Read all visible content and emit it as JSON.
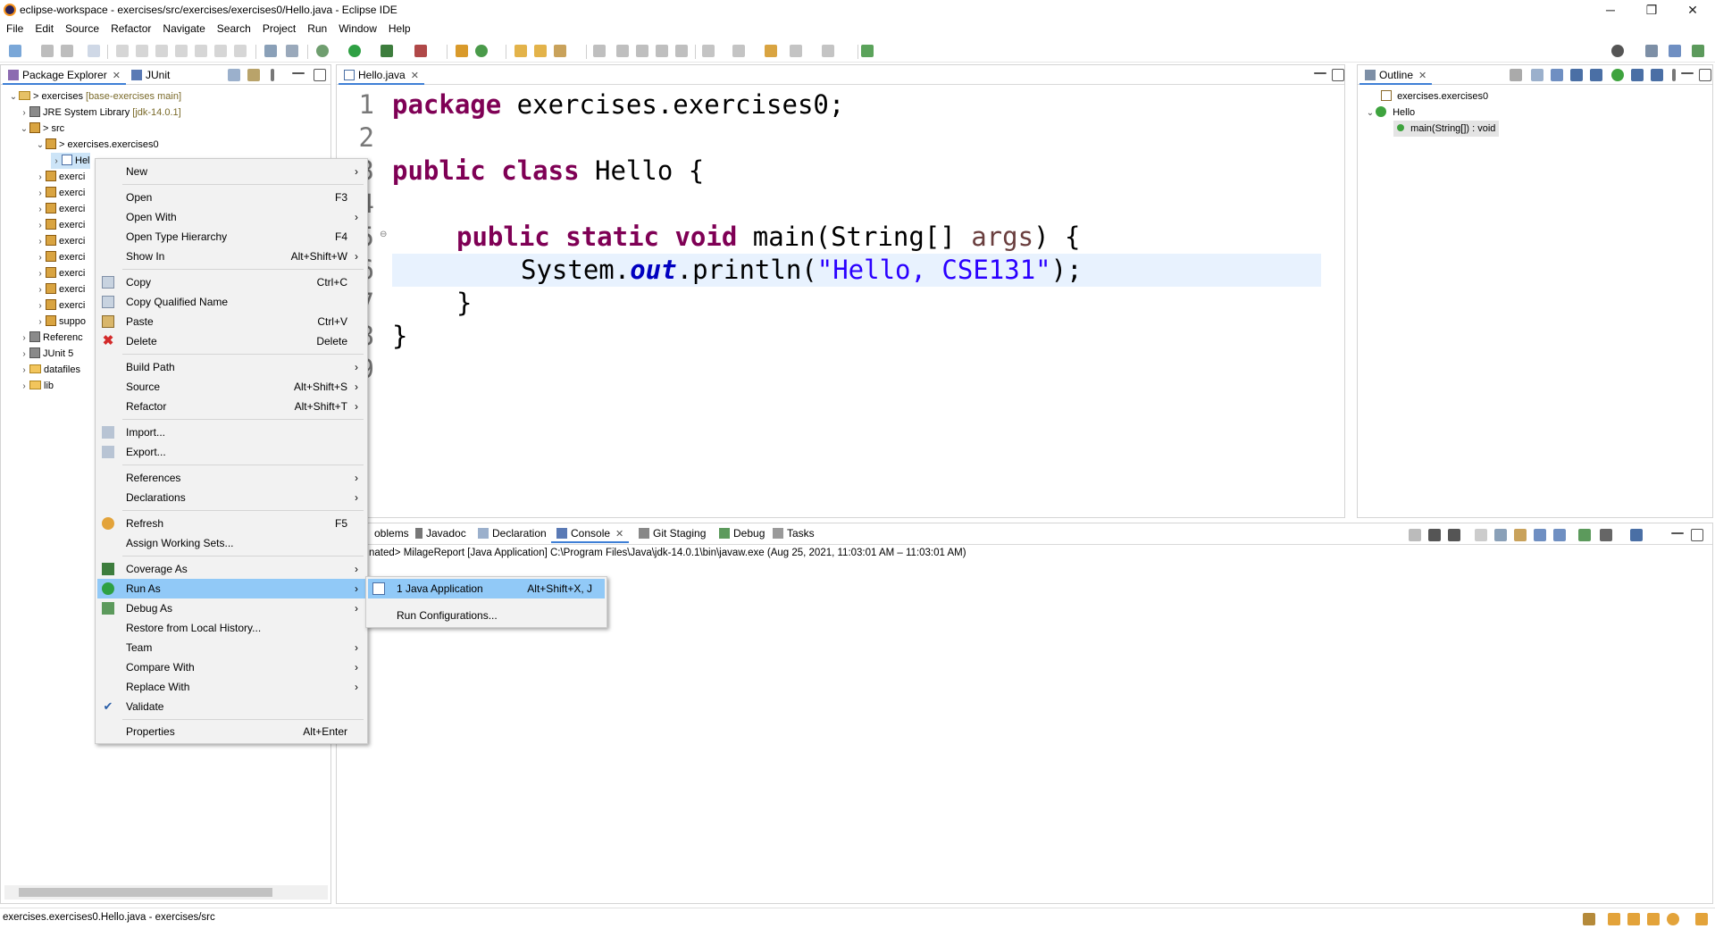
{
  "window": {
    "title": "eclipse-workspace - exercises/src/exercises/exercises0/Hello.java - Eclipse IDE",
    "minimize": "─",
    "maximize": "❐",
    "close": "✕"
  },
  "menubar": [
    "File",
    "Edit",
    "Source",
    "Refactor",
    "Navigate",
    "Search",
    "Project",
    "Run",
    "Window",
    "Help"
  ],
  "left_panel": {
    "tabs": [
      {
        "label": "Package Explorer",
        "close": "✕"
      },
      {
        "label": "JUnit"
      }
    ],
    "tree": [
      {
        "arrow": "⌄",
        "text": "> exercises",
        "decor": " [base-exercises main]"
      },
      {
        "arrow": "›",
        "text": "JRE System Library",
        "decor": " [jdk-14.0.1]"
      },
      {
        "arrow": "⌄",
        "text": "> src"
      },
      {
        "arrow": "⌄",
        "text": "> exercises.exercises0"
      },
      {
        "arrow": "›",
        "text": "Hel"
      },
      {
        "arrow": "›",
        "text": "exerci"
      },
      {
        "arrow": "›",
        "text": "exerci"
      },
      {
        "arrow": "›",
        "text": "exerci"
      },
      {
        "arrow": "›",
        "text": "exerci"
      },
      {
        "arrow": "›",
        "text": "exerci"
      },
      {
        "arrow": "›",
        "text": "exerci"
      },
      {
        "arrow": "›",
        "text": "exerci"
      },
      {
        "arrow": "›",
        "text": "exerci"
      },
      {
        "arrow": "›",
        "text": "exerci"
      },
      {
        "arrow": "›",
        "text": "suppo"
      },
      {
        "arrow": "›",
        "text": "Referenc"
      },
      {
        "arrow": "›",
        "text": "JUnit 5"
      },
      {
        "arrow": "›",
        "text": "datafiles"
      },
      {
        "arrow": "›",
        "text": "lib"
      }
    ]
  },
  "editor": {
    "tab": {
      "label": "Hello.java",
      "close": "✕"
    },
    "line_numbers": [
      "1",
      "2",
      "3",
      "4",
      "5",
      "6",
      "7",
      "8",
      "9"
    ],
    "code": {
      "l1_kw": "package",
      "l1_rest": " exercises.exercises0;",
      "l3_kw1": "public",
      "l3_kw2": "class",
      "l3_rest": " Hello {",
      "l5_kw1": "public",
      "l5_kw2": "static",
      "l5_kw3": "void",
      "l5_mid": " main(String[] ",
      "l5_arg": "args",
      "l5_end": ") {",
      "l6_a": "System.",
      "l6_field": "out",
      "l6_b": ".println(",
      "l6_str": "\"Hello, CSE131\"",
      "l6_c": ");",
      "l7": "}",
      "l8": "}"
    }
  },
  "outline": {
    "tab": {
      "label": "Outline",
      "close": "✕"
    },
    "items": [
      {
        "text": "exercises.exercises0"
      },
      {
        "text": "Hello"
      },
      {
        "text": "main(String[]) : void"
      }
    ]
  },
  "bottom_panel": {
    "tabs": [
      "oblems",
      "Javadoc",
      "Declaration",
      "Console",
      "Git Staging",
      "Debug",
      "Tasks"
    ],
    "console_close": "✕",
    "console_text": "nated> MilageReport [Java Application] C:\\Program Files\\Java\\jdk-14.0.1\\bin\\javaw.exe  (Aug 25, 2021, 11:03:01 AM – 11:03:01 AM)"
  },
  "context_menu": {
    "items": [
      {
        "label": "New",
        "shortcut": "",
        "submenu": true
      },
      {
        "label": "Open",
        "shortcut": "F3"
      },
      {
        "label": "Open With",
        "shortcut": "",
        "submenu": true
      },
      {
        "label": "Open Type Hierarchy",
        "shortcut": "F4"
      },
      {
        "label": "Show In",
        "shortcut": "Alt+Shift+W",
        "submenu": true
      },
      {
        "label": "Copy",
        "shortcut": "Ctrl+C"
      },
      {
        "label": "Copy Qualified Name",
        "shortcut": ""
      },
      {
        "label": "Paste",
        "shortcut": "Ctrl+V"
      },
      {
        "label": "Delete",
        "shortcut": "Delete"
      },
      {
        "label": "Build Path",
        "shortcut": "",
        "submenu": true
      },
      {
        "label": "Source",
        "shortcut": "Alt+Shift+S",
        "submenu": true
      },
      {
        "label": "Refactor",
        "shortcut": "Alt+Shift+T",
        "submenu": true
      },
      {
        "label": "Import...",
        "shortcut": ""
      },
      {
        "label": "Export...",
        "shortcut": ""
      },
      {
        "label": "References",
        "shortcut": "",
        "submenu": true
      },
      {
        "label": "Declarations",
        "shortcut": "",
        "submenu": true
      },
      {
        "label": "Refresh",
        "shortcut": "F5"
      },
      {
        "label": "Assign Working Sets...",
        "shortcut": ""
      },
      {
        "label": "Coverage As",
        "shortcut": "",
        "submenu": true
      },
      {
        "label": "Run As",
        "shortcut": "",
        "submenu": true,
        "highlighted": true
      },
      {
        "label": "Debug As",
        "shortcut": "",
        "submenu": true
      },
      {
        "label": "Restore from Local History...",
        "shortcut": ""
      },
      {
        "label": "Team",
        "shortcut": "",
        "submenu": true
      },
      {
        "label": "Compare With",
        "shortcut": "",
        "submenu": true
      },
      {
        "label": "Replace With",
        "shortcut": "",
        "submenu": true
      },
      {
        "label": "Validate",
        "shortcut": ""
      },
      {
        "label": "Properties",
        "shortcut": "Alt+Enter"
      }
    ],
    "submenu_arrow": "›"
  },
  "submenu": {
    "items": [
      {
        "label": "1 Java Application",
        "shortcut": "Alt+Shift+X, J",
        "highlighted": true
      },
      {
        "label": "Run Configurations...",
        "shortcut": ""
      }
    ]
  },
  "statusbar": {
    "text": "exercises.exercises0.Hello.java - exercises/src"
  },
  "colors": {
    "keyword": "#7f0055",
    "string": "#2a00ff",
    "highlight": "#91c9f7",
    "current_line": "#e8f2fe"
  }
}
